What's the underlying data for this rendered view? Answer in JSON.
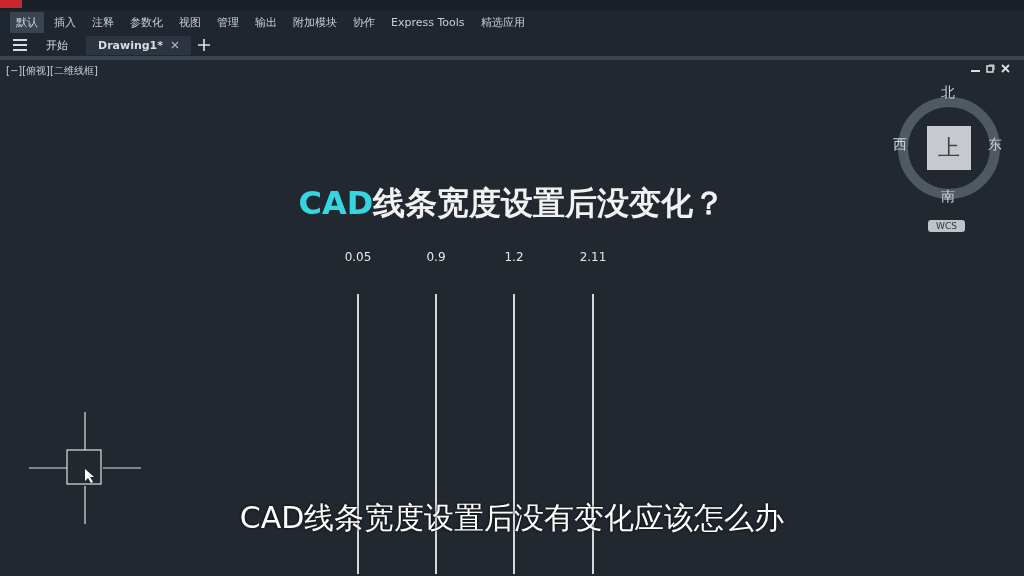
{
  "ribbon_tabs": [
    {
      "label": "默认",
      "selected": true
    },
    {
      "label": "插入",
      "selected": false
    },
    {
      "label": "注释",
      "selected": false
    },
    {
      "label": "参数化",
      "selected": false
    },
    {
      "label": "视图",
      "selected": false
    },
    {
      "label": "管理",
      "selected": false
    },
    {
      "label": "输出",
      "selected": false
    },
    {
      "label": "附加模块",
      "selected": false
    },
    {
      "label": "协作",
      "selected": false
    },
    {
      "label": "Express Tools",
      "selected": false
    },
    {
      "label": "精选应用",
      "selected": false
    }
  ],
  "file_tabs": [
    {
      "label": "开始",
      "selected": false
    },
    {
      "label": "Drawing1*",
      "selected": true
    }
  ],
  "viewport": {
    "label": "[−][俯视][二维线框]",
    "heading_highlight": "CAD",
    "heading_rest": "线条宽度设置后没变化？",
    "lines": [
      {
        "label": "0.05"
      },
      {
        "label": "0.9"
      },
      {
        "label": "1.2"
      },
      {
        "label": "2.11"
      }
    ],
    "viewcube": {
      "north": "北",
      "south": "南",
      "east": "东",
      "west": "西",
      "face": "上",
      "wcs": "WCS"
    }
  },
  "subtitle": "CAD线条宽度设置后没有变化应该怎么办"
}
